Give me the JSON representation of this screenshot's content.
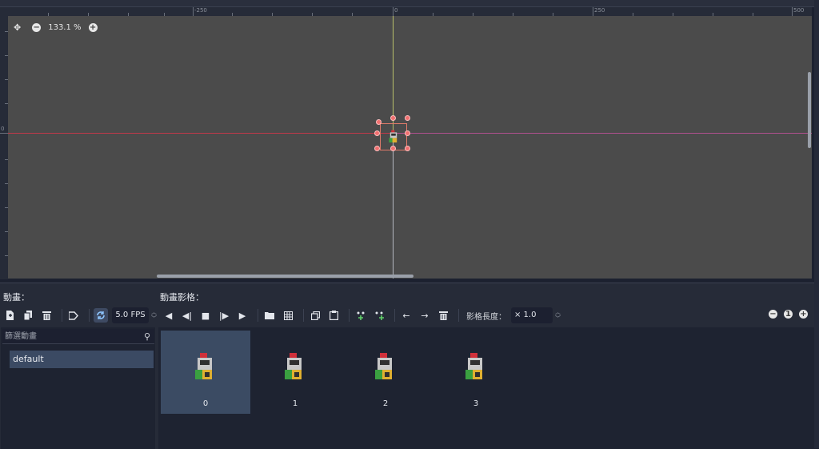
{
  "viewport": {
    "zoom_label": "133.1 %",
    "ruler_labels": {
      "neg250": "-250",
      "zero": "0",
      "pos250": "250",
      "pos500": "500",
      "v_zero": "0"
    }
  },
  "animations_panel": {
    "title": "動畫：",
    "search_placeholder": "篩選動畫",
    "items": [
      {
        "label": "default"
      }
    ]
  },
  "frames_panel": {
    "title": "動畫影格：",
    "fps_value": "5.0 FPS",
    "frame_length_label": "影格長度：",
    "frame_length_value": "× 1.0",
    "frames": [
      {
        "label": "0"
      },
      {
        "label": "1"
      },
      {
        "label": "2"
      },
      {
        "label": "3"
      }
    ],
    "zoom_reset_label": "1"
  },
  "colors": {
    "x_axis": "#c0384a",
    "y_axis": "#b9c06a",
    "selection": "#3b4a63",
    "canvas": "#4b4b4b"
  }
}
